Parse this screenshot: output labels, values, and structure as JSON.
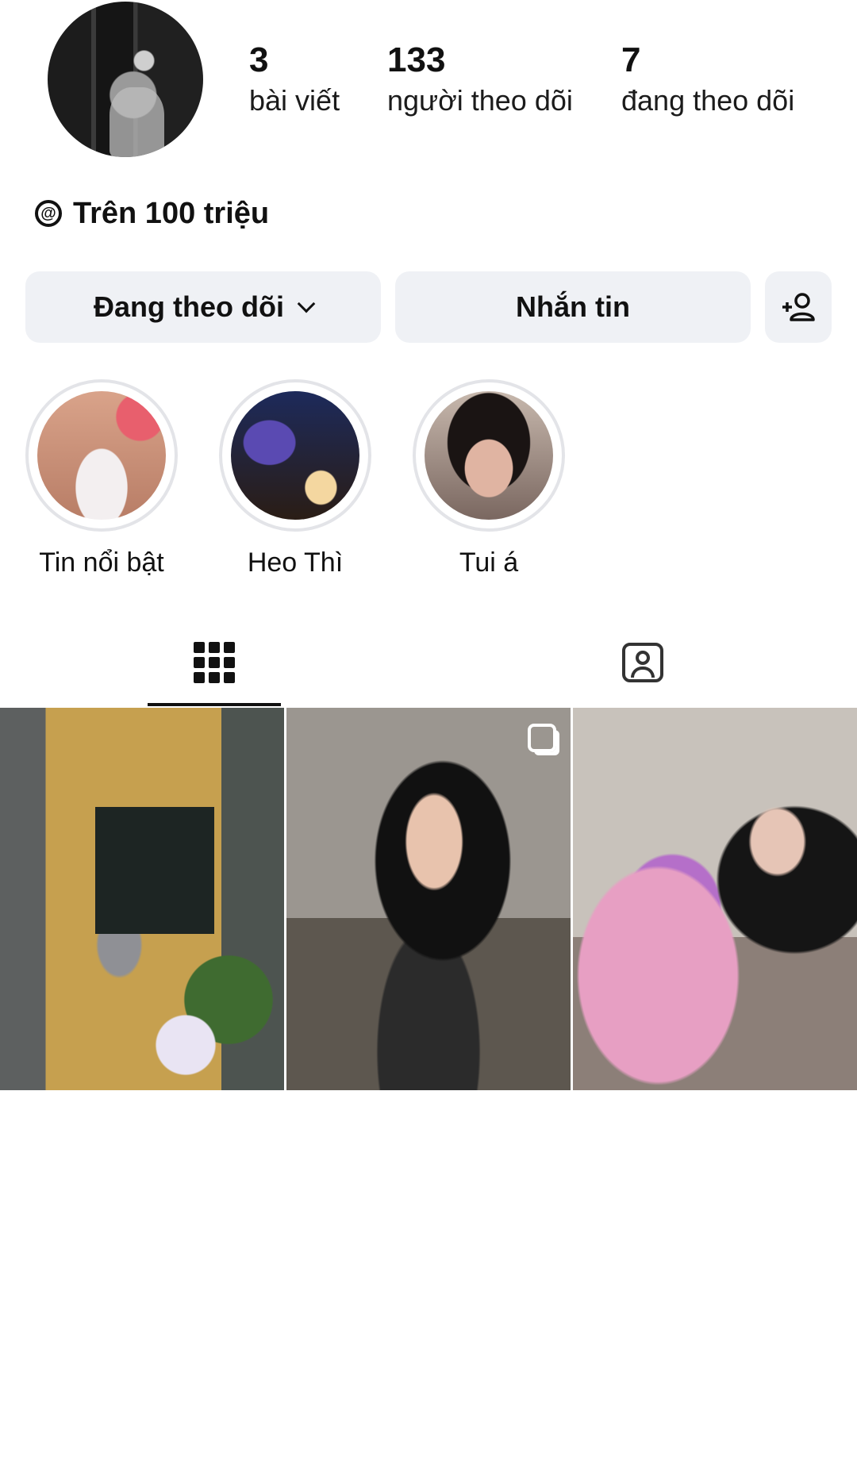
{
  "profile": {
    "stats": [
      {
        "value": "3",
        "label": "bài viết"
      },
      {
        "value": "133",
        "label": "người theo dõi"
      },
      {
        "value": "7",
        "label": "đang theo dõi"
      }
    ],
    "threads_label": "Trên 100 triệu"
  },
  "actions": {
    "following_label": "Đang theo dõi",
    "message_label": "Nhắn tin",
    "add_person_icon": "add-person-icon"
  },
  "highlights": [
    {
      "label": "Tin nổi bật"
    },
    {
      "label": "Heo Thì"
    },
    {
      "label": "Tui á"
    }
  ],
  "tabs": {
    "active": "grid",
    "items": [
      "grid-icon",
      "tagged-icon"
    ]
  },
  "posts": [
    {
      "type": "photo"
    },
    {
      "type": "carousel"
    },
    {
      "type": "photo"
    }
  ]
}
